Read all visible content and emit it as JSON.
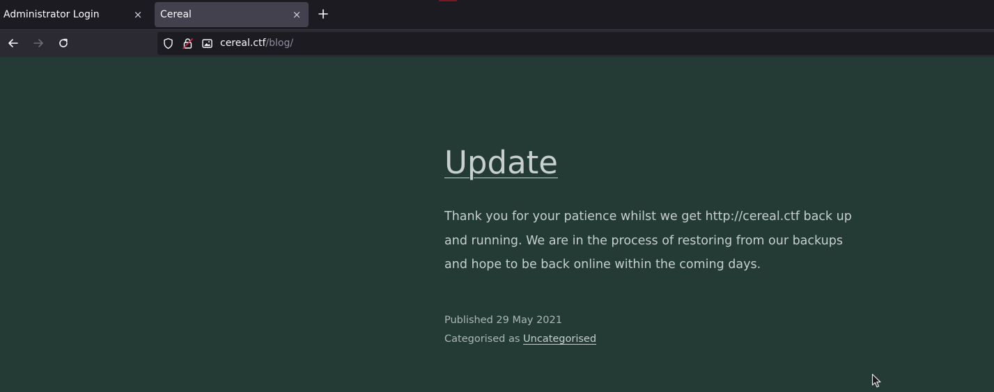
{
  "tabs": [
    {
      "label": "Administrator Login",
      "close": "×"
    },
    {
      "label": "Cereal",
      "close": "×"
    }
  ],
  "new_tab": "+",
  "urlbar": {
    "host": "cereal.ctf",
    "path": "/blog/"
  },
  "icons": {
    "back": "back-arrow-icon",
    "forward": "forward-arrow-icon",
    "reload": "reload-icon",
    "shield": "shield-icon",
    "lock": "insecure-lock-icon",
    "image": "image-icon",
    "cursor": "mouse-pointer-icon"
  },
  "post": {
    "title": "Update",
    "body": "Thank you for your patience whilst we get http://cereal.ctf back up and running. We are in the process of restoring from our backups and hope to be back online within the coming days.",
    "published": "Published 29 May 2021",
    "categorised_prefix": "Categorised as",
    "category": "Uncategorised"
  },
  "colors": {
    "page_background": "#233a35",
    "tabstrip": "#1c1b22",
    "active_tab": "#42414d",
    "navbar": "#2b2a33",
    "text": "#c7d0cc"
  }
}
